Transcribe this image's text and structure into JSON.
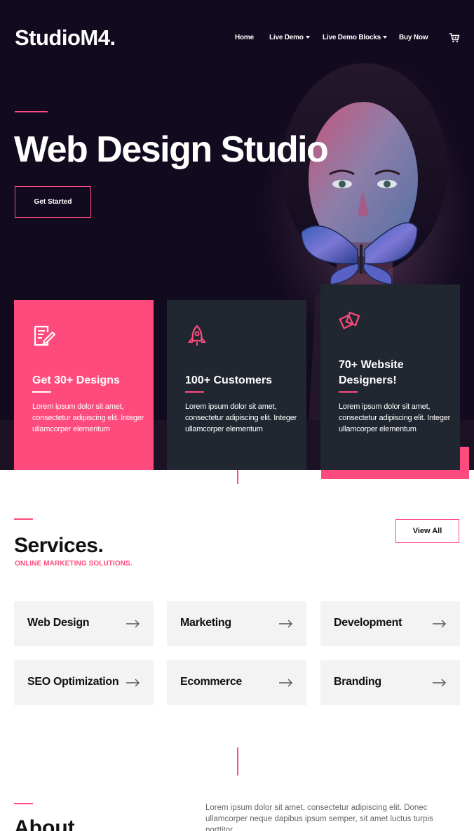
{
  "header": {
    "logo": "StudioM4.",
    "nav": [
      {
        "label": "Home",
        "dropdown": false
      },
      {
        "label": "Live Demo",
        "dropdown": true
      },
      {
        "label": "Live Demo Blocks",
        "dropdown": true
      },
      {
        "label": "Buy Now",
        "dropdown": false
      }
    ],
    "cart_icon": "shopping-cart-icon"
  },
  "hero": {
    "title": "Web Design Studio",
    "button_label": "Get Started",
    "image": "painted-face-with-butterfly-photo"
  },
  "features": [
    {
      "icon": "document-edit-icon",
      "title": "Get 30+ Designs",
      "text": "Lorem ipsum dolor sit amet, consectetur adipiscing elit. Integer ullamcorper elementum"
    },
    {
      "icon": "rocket-icon",
      "title": "100+ Customers",
      "text": "Lorem ipsum dolor sit amet, consectetur adipiscing elit. Integer ullamcorper elementum"
    },
    {
      "icon": "diamond-squares-icon",
      "title": "70+ Website Designers!",
      "text": "Lorem ipsum dolor sit amet, consectetur adipiscing elit. Integer ullamcorper elementum"
    }
  ],
  "services": {
    "title": "Services.",
    "subtitle": "ONLINE MARKETING SOLUTIONS.",
    "view_all": "View All",
    "items": [
      {
        "label": "Web Design"
      },
      {
        "label": "Marketing"
      },
      {
        "label": "Development"
      },
      {
        "label": "SEO Optimization"
      },
      {
        "label": "Ecommerce"
      },
      {
        "label": "Branding"
      }
    ],
    "arrow_icon": "arrow-right-icon"
  },
  "about": {
    "title": "About",
    "text": "Lorem ipsum dolor sit amet, consectetur adipiscing elit. Donec ullamcorper neque dapibus ipsum semper, sit amet luctus turpis porttitor."
  },
  "colors": {
    "accent": "#ff4a7d",
    "hero_bg": "#120a1f",
    "card_dark": "#212731",
    "service_bg": "#f3f3f3"
  }
}
